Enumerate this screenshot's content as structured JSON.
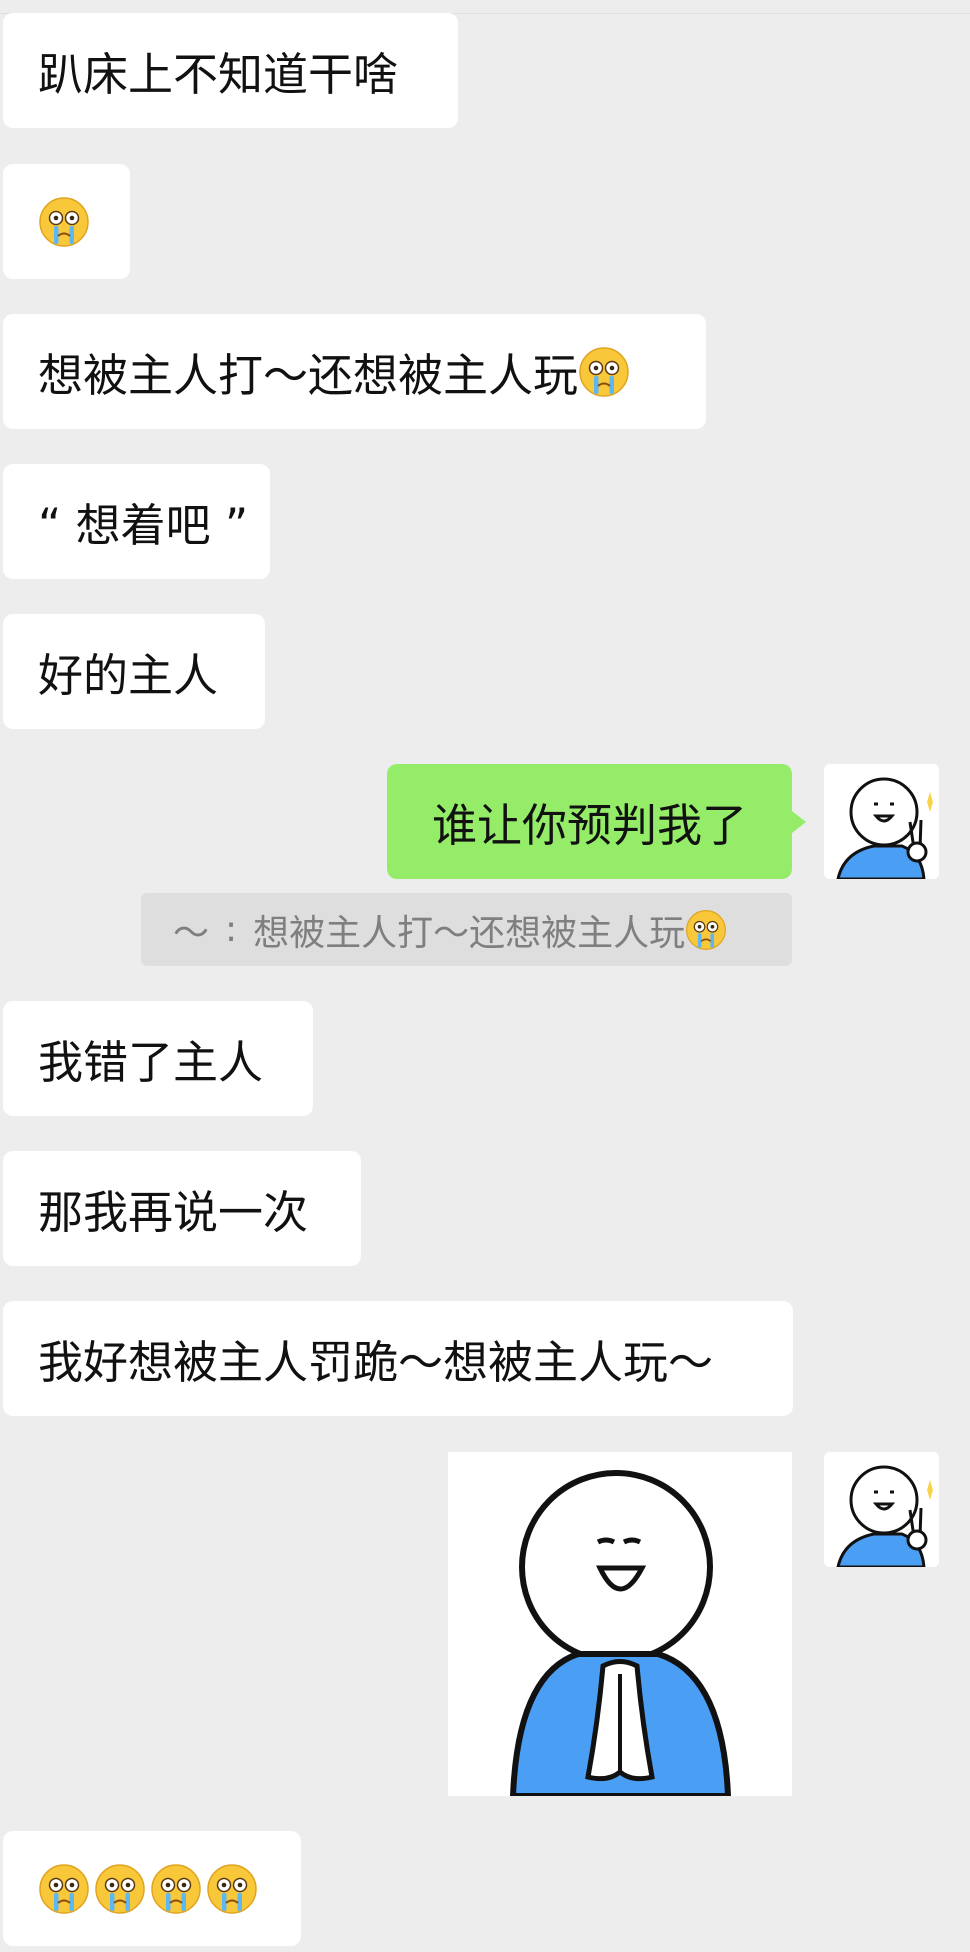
{
  "messages": [
    {
      "text": "趴床上不知道干啥"
    },
    {
      "text": ""
    },
    {
      "text": "想被主人打～还想被主人玩"
    },
    {
      "text": "“ 想着吧 ”"
    },
    {
      "text": "好的主人"
    },
    {
      "text": "谁让你预判我了"
    },
    {
      "text": "我错了主人"
    },
    {
      "text": "那我再说一次"
    },
    {
      "text": "我好想被主人罚跪～想被主人玩～"
    }
  ],
  "quote": {
    "sender": "～",
    "separator": ":",
    "text": "想被主人打～还想被主人玩"
  },
  "icons": {
    "emoji": "crying-emoji",
    "avatar": "peace-sign-cartoon-avatar",
    "sticker": "praying-cartoon-sticker"
  },
  "colors": {
    "background": "#ededed",
    "incoming_bubble": "#ffffff",
    "outgoing_bubble": "#95ec69",
    "quote_bg": "#dedede",
    "shirt_blue": "#4a9ff5"
  }
}
